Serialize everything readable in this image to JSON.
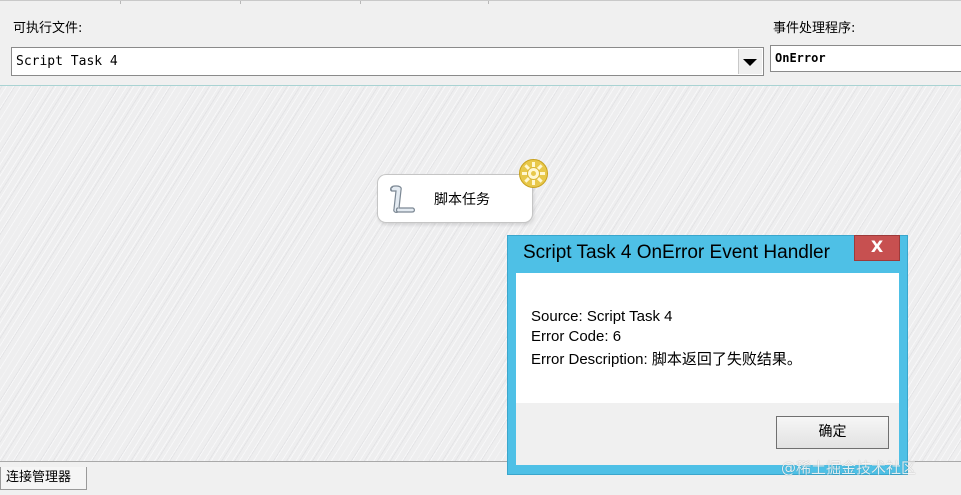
{
  "header": {
    "executable_label": "可执行文件:",
    "executable_value": "Script Task 4",
    "event_handler_label": "事件处理程序:",
    "event_handler_value": "OnError"
  },
  "canvas": {
    "task_label": "脚本任务"
  },
  "dialog": {
    "title": "Script Task 4 OnError Event Handler",
    "close_glyph": "X",
    "lines": [
      "Source: Script Task 4",
      "Error Code: 6",
      "Error Description: 脚本返回了失败结果。"
    ],
    "ok_label": "确定"
  },
  "bottom_tab": {
    "label": "连接管理器"
  },
  "watermark": "@稀土掘金技术社区",
  "colors": {
    "dialog_frame": "#4ec0e6",
    "close_button": "#c75050",
    "canvas_bg": "#eeeeef"
  },
  "icons": {
    "task": "scroll-icon",
    "badge": "gear-icon",
    "dropdown": "chevron-down-icon"
  }
}
